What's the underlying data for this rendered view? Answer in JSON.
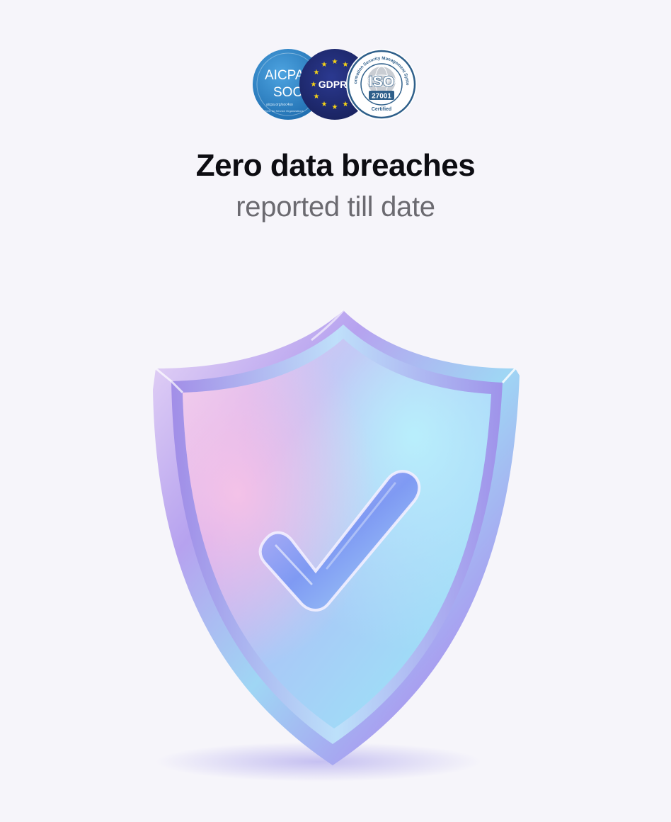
{
  "badges": [
    {
      "name": "AICPA SOC",
      "line1": "AICPA",
      "line2": "SOC",
      "small": "aicpa.org/soc4so",
      "rim_text": "SOC for Service Organizations",
      "color": "#2f7fc1"
    },
    {
      "name": "GDPR",
      "text": "GDPR",
      "color": "#1f2a6e",
      "star_color": "#f7d416"
    },
    {
      "name": "ISO 27001",
      "arc_text": "Information Security Management System",
      "line1": "ISO",
      "line2": "27001",
      "bottom": "Certified",
      "color": "#2e5f8a"
    }
  ],
  "headline": "Zero data breaches",
  "subline": "reported till date",
  "colors": {
    "background": "#f6f5fa",
    "headline": "#0d0d12",
    "subline": "#6b6a70"
  },
  "illustration": {
    "shield_icon": "shield-with-checkmark"
  }
}
